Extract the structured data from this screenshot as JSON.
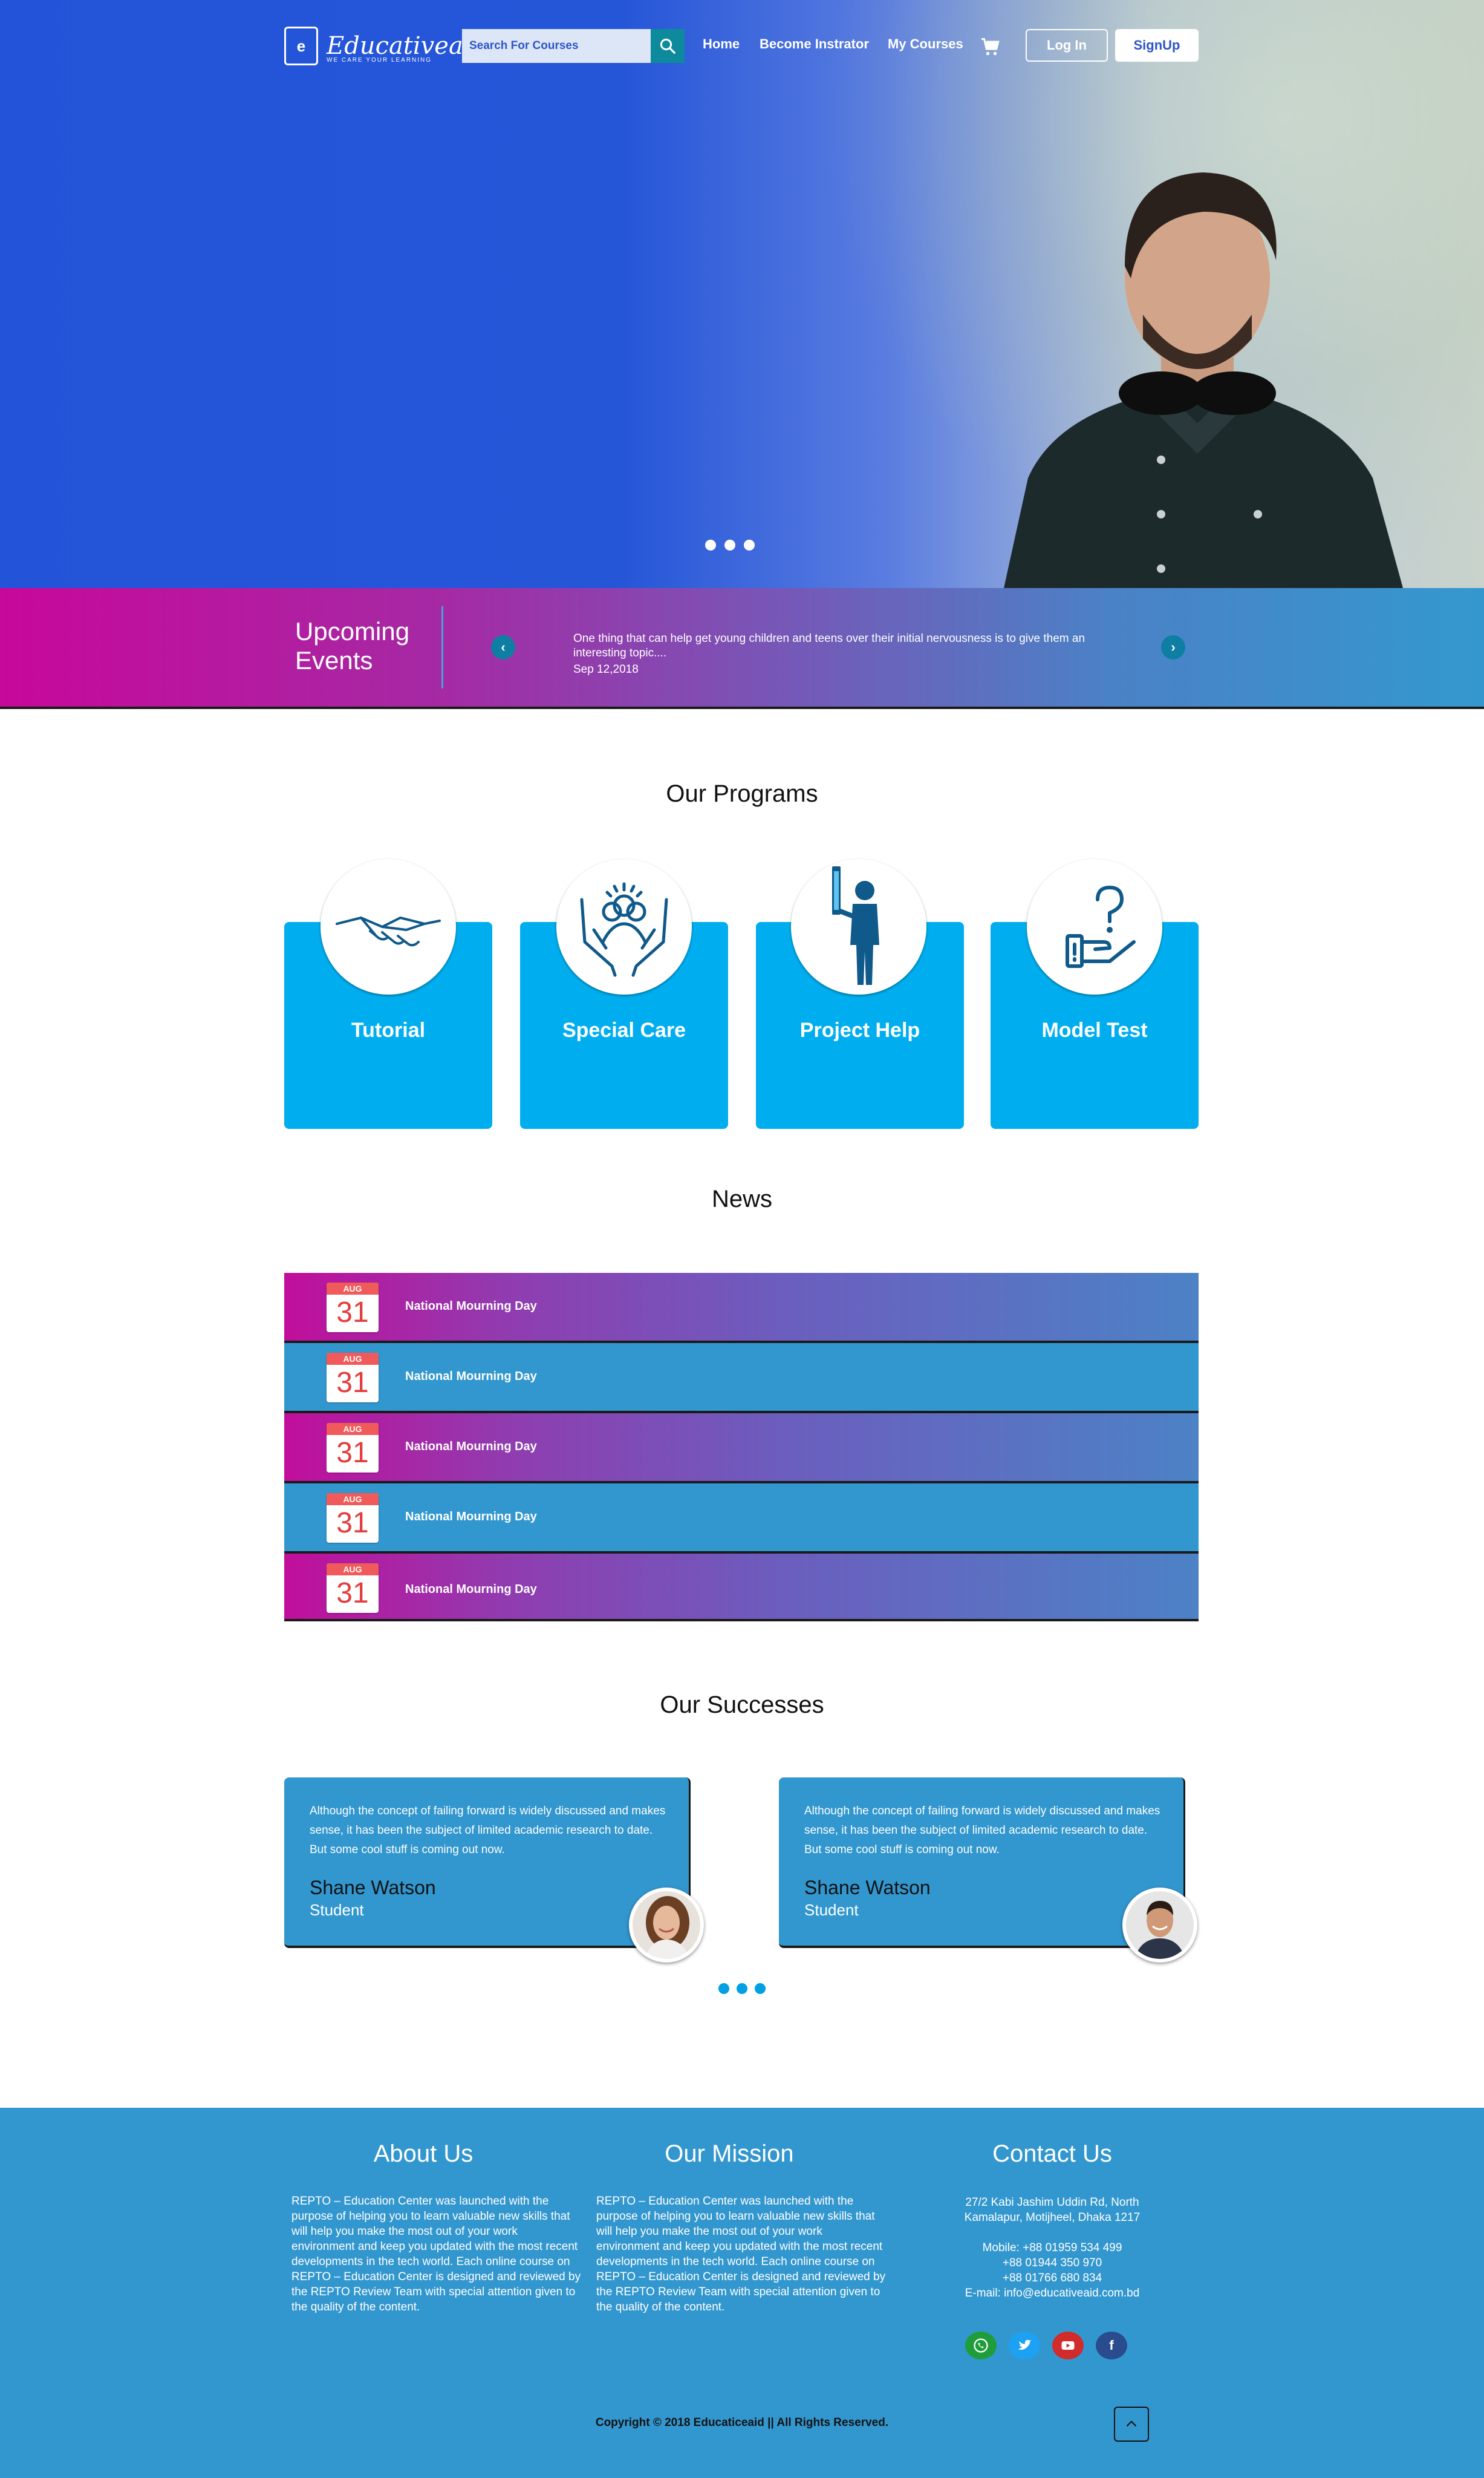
{
  "header": {
    "logo_text": "Educativeaid",
    "logo_tagline": "WE CARE YOUR LEARNING",
    "search_placeholder": "Search For Courses",
    "nav": [
      "Home",
      "Become Instrator",
      "My Courses"
    ],
    "login_label": "Log In",
    "signup_label": "SignUp"
  },
  "hero": {
    "slide_count": 3,
    "active_slide": 1
  },
  "events": {
    "title": "Upcoming Events",
    "text": "One thing that can help get young children and teens over their initial nervousness is to give them an interesting topic....",
    "date": "Sep 12,2018"
  },
  "programs": {
    "title": "Our Programs",
    "items": [
      {
        "label": "Tutorial",
        "icon": "handshake-icon"
      },
      {
        "label": "Special Care",
        "icon": "care-hands-icon"
      },
      {
        "label": "Project Help",
        "icon": "person-project-icon"
      },
      {
        "label": "Model Test",
        "icon": "question-hand-icon"
      }
    ]
  },
  "news": {
    "title": "News",
    "items": [
      {
        "month": "AUG",
        "day": "31",
        "title": "National Mourning Day"
      },
      {
        "month": "AUG",
        "day": "31",
        "title": "National Mourning Day"
      },
      {
        "month": "AUG",
        "day": "31",
        "title": "National Mourning Day"
      },
      {
        "month": "AUG",
        "day": "31",
        "title": "National Mourning Day"
      },
      {
        "month": "AUG",
        "day": "31",
        "title": "National Mourning Day"
      }
    ]
  },
  "successes": {
    "title": "Our Successes",
    "cards": [
      {
        "text": "Although the concept of failing forward is widely discussed and makes sense, it has been the subject of limited academic research to date. But some cool stuff is coming out now.",
        "name": "Shane Watson",
        "role": "Student"
      },
      {
        "text": "Although the concept of failing forward is widely discussed and makes sense, it has been the subject of limited academic research to date. But some cool stuff is coming out now.",
        "name": "Shane Watson",
        "role": "Student"
      }
    ],
    "slide_count": 3
  },
  "footer": {
    "about_title": "About Us",
    "about_text": "REPTO – Education Center was launched with the purpose of helping you to learn valuable new skills that will help you make the most out of your work environment and keep you updated with the most recent developments in the tech world. Each online course on REPTO – Education Center is designed and reviewed by the REPTO Review Team with special attention given to the quality of the content.",
    "mission_title": "Our Mission",
    "mission_text": "REPTO – Education Center was launched with the purpose of helping you to learn valuable new skills that will help you make the most out of your work environment and keep you updated with the most recent developments in the tech world. Each online course on REPTO – Education Center is designed and reviewed by the REPTO Review Team with special attention given to the quality of the content.",
    "contact_title": "Contact Us",
    "address_line1": "27/2 Kabi Jashim Uddin Rd, North",
    "address_line2": "Kamalapur, Motijheel, Dhaka 1217",
    "mobile_line1": "Mobile: +88 01959 534 499",
    "mobile_line2": "+88 01944 350 970",
    "mobile_line3": "+88 01766 680 834",
    "email_line": "E-mail: info@educativeaid.com.bd",
    "social": [
      {
        "name": "whatsapp",
        "color": "#1f9d3a"
      },
      {
        "name": "twitter",
        "color": "#1da1f2"
      },
      {
        "name": "youtube",
        "color": "#d22b2b"
      },
      {
        "name": "facebook",
        "color": "#2a4b8d"
      }
    ],
    "copyright": "Copyright © 2018 Educaticeaid || All Rights Reserved."
  },
  "colors": {
    "primary_blue": "#2656d8",
    "program_cyan": "#00aeef",
    "section_blue": "#3297cf",
    "magenta": "#c7089a"
  }
}
